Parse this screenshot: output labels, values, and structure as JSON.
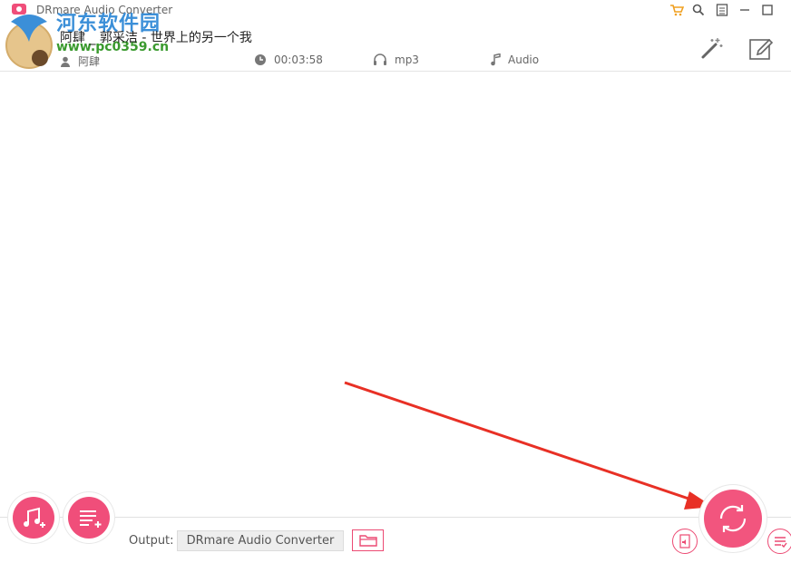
{
  "window": {
    "app_title": "DRmare Audio Converter",
    "controls": [
      "cart-icon",
      "search-icon",
      "menu-icon",
      "minimize-icon",
      "maximize-icon"
    ]
  },
  "watermark": {
    "title": "河东软件园",
    "url": "www.pc0359.cn"
  },
  "track": {
    "title": "阿肆 _ 郭采洁 - 世界上的另一个我",
    "artist": "阿肆",
    "duration": "00:03:58",
    "format": "mp3",
    "type": "Audio"
  },
  "tools": [
    "magic-wand-icon",
    "edit-icon"
  ],
  "footer": {
    "output_label": "Output:",
    "output_path": "DRmare Audio Converter"
  },
  "colors": {
    "accent": "#f04e7a",
    "annotation_arrow": "#e83025"
  }
}
